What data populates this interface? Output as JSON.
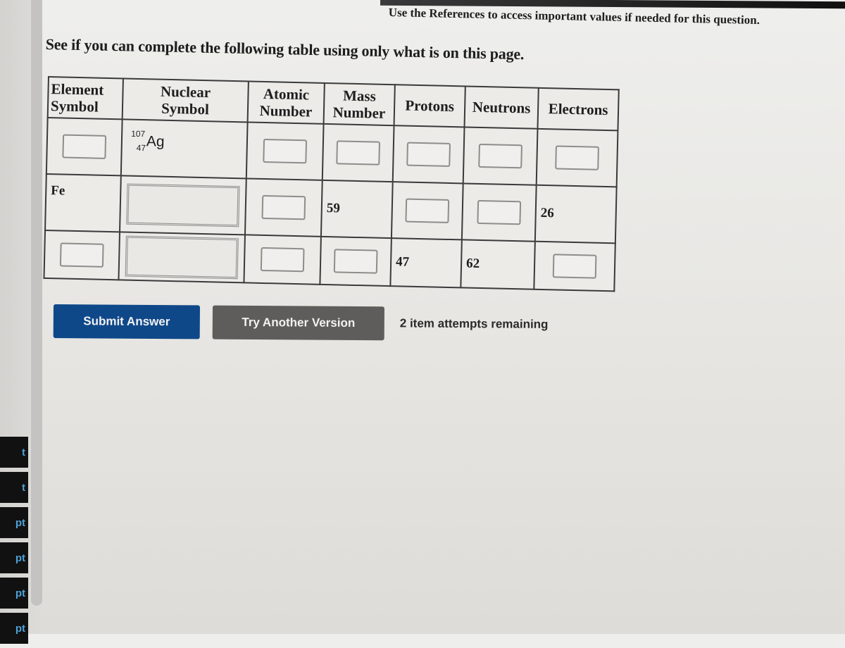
{
  "header": {
    "references_note": "Use the References to access important values if needed for this question."
  },
  "question": {
    "intro": "See if you can complete the following table using only what is on this page."
  },
  "table": {
    "headers": [
      {
        "line1": "Element",
        "line2": "Symbol"
      },
      {
        "line1": "Nuclear",
        "line2": "Symbol"
      },
      {
        "line1": "Atomic",
        "line2": "Number"
      },
      {
        "line1": "Mass",
        "line2": "Number"
      },
      {
        "line1": "Protons",
        "line2": ""
      },
      {
        "line1": "Neutrons",
        "line2": ""
      },
      {
        "line1": "Electrons",
        "line2": ""
      }
    ],
    "rows": [
      {
        "element_symbol": null,
        "nuclear_symbol": {
          "mass": "107",
          "atomic": "47",
          "symbol": "Ag"
        },
        "atomic_number": null,
        "mass_number": null,
        "protons": null,
        "neutrons": null,
        "electrons": null
      },
      {
        "element_symbol": "Fe",
        "nuclear_symbol": null,
        "atomic_number": null,
        "mass_number": "59",
        "protons": null,
        "neutrons": null,
        "electrons": "26"
      },
      {
        "element_symbol": null,
        "nuclear_symbol": null,
        "atomic_number": null,
        "mass_number": null,
        "protons": "47",
        "neutrons": "62",
        "electrons": null
      }
    ]
  },
  "actions": {
    "submit_label": "Submit Answer",
    "try_another_label": "Try Another Version",
    "attempts_text": "2 item attempts remaining"
  },
  "sidebar": {
    "items": [
      "t",
      "t",
      "pt",
      "pt",
      "pt",
      "pt"
    ]
  },
  "colors": {
    "submit_button": "#0f4889",
    "try_button": "#5f5d5b",
    "sidebar_text": "#4ea2d8"
  }
}
